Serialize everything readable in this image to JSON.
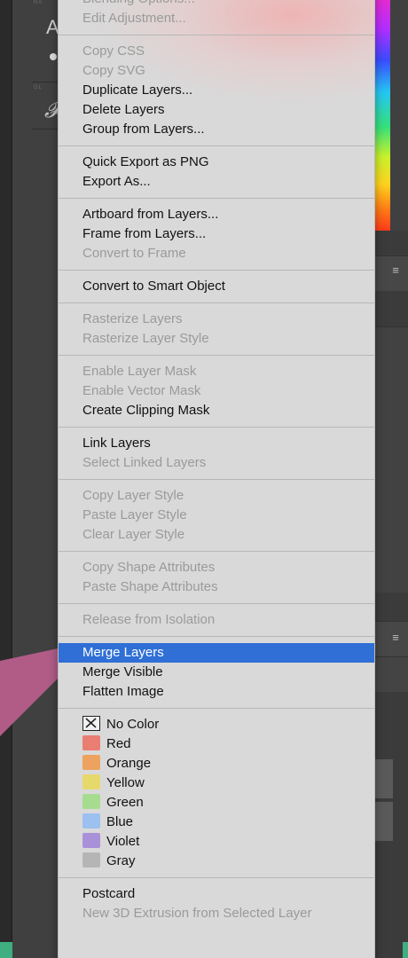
{
  "menu": {
    "groups": [
      [
        {
          "label": "Blending Options...",
          "enabled": false
        },
        {
          "label": "Edit Adjustment...",
          "enabled": false
        }
      ],
      [
        {
          "label": "Copy CSS",
          "enabled": false
        },
        {
          "label": "Copy SVG",
          "enabled": false
        },
        {
          "label": "Duplicate Layers...",
          "enabled": true
        },
        {
          "label": "Delete Layers",
          "enabled": true
        },
        {
          "label": "Group from Layers...",
          "enabled": true
        }
      ],
      [
        {
          "label": "Quick Export as PNG",
          "enabled": true
        },
        {
          "label": "Export As...",
          "enabled": true
        }
      ],
      [
        {
          "label": "Artboard from Layers...",
          "enabled": true
        },
        {
          "label": "Frame from Layers...",
          "enabled": true
        },
        {
          "label": "Convert to Frame",
          "enabled": false
        }
      ],
      [
        {
          "label": "Convert to Smart Object",
          "enabled": true
        }
      ],
      [
        {
          "label": "Rasterize Layers",
          "enabled": false
        },
        {
          "label": "Rasterize Layer Style",
          "enabled": false
        }
      ],
      [
        {
          "label": "Enable Layer Mask",
          "enabled": false
        },
        {
          "label": "Enable Vector Mask",
          "enabled": false
        },
        {
          "label": "Create Clipping Mask",
          "enabled": true
        }
      ],
      [
        {
          "label": "Link Layers",
          "enabled": true
        },
        {
          "label": "Select Linked Layers",
          "enabled": false
        }
      ],
      [
        {
          "label": "Copy Layer Style",
          "enabled": false
        },
        {
          "label": "Paste Layer Style",
          "enabled": false
        },
        {
          "label": "Clear Layer Style",
          "enabled": false
        }
      ],
      [
        {
          "label": "Copy Shape Attributes",
          "enabled": false
        },
        {
          "label": "Paste Shape Attributes",
          "enabled": false
        }
      ],
      [
        {
          "label": "Release from Isolation",
          "enabled": false
        }
      ],
      [
        {
          "label": "Merge Layers",
          "enabled": true,
          "highlighted": true
        },
        {
          "label": "Merge Visible",
          "enabled": true
        },
        {
          "label": "Flatten Image",
          "enabled": true
        }
      ],
      [
        {
          "label": "No Color",
          "enabled": true,
          "nocolor": true
        },
        {
          "label": "Red",
          "enabled": true,
          "swatch": "#ea7e72"
        },
        {
          "label": "Orange",
          "enabled": true,
          "swatch": "#eda25f"
        },
        {
          "label": "Yellow",
          "enabled": true,
          "swatch": "#e7d86c"
        },
        {
          "label": "Green",
          "enabled": true,
          "swatch": "#a6dc8f"
        },
        {
          "label": "Blue",
          "enabled": true,
          "swatch": "#9cc0f0"
        },
        {
          "label": "Violet",
          "enabled": true,
          "swatch": "#a891d9"
        },
        {
          "label": "Gray",
          "enabled": true,
          "swatch": "#b5b5b5"
        }
      ],
      [
        {
          "label": "Postcard",
          "enabled": true
        },
        {
          "label": "New 3D Extrusion from Selected Layer",
          "enabled": false
        }
      ]
    ]
  },
  "background": {
    "glyph_a": "A",
    "glyph_script": "𝓕",
    "panel_menu_icon": "≡"
  },
  "colors": {
    "highlight": "#2f6fd6",
    "menu_bg": "#d9d9d9",
    "callout": "#b05c87",
    "accent_green": "#3fae80"
  },
  "icons": {
    "menu_icon": "hamburger-menu-icon",
    "no_color_icon": "x-box-icon"
  }
}
